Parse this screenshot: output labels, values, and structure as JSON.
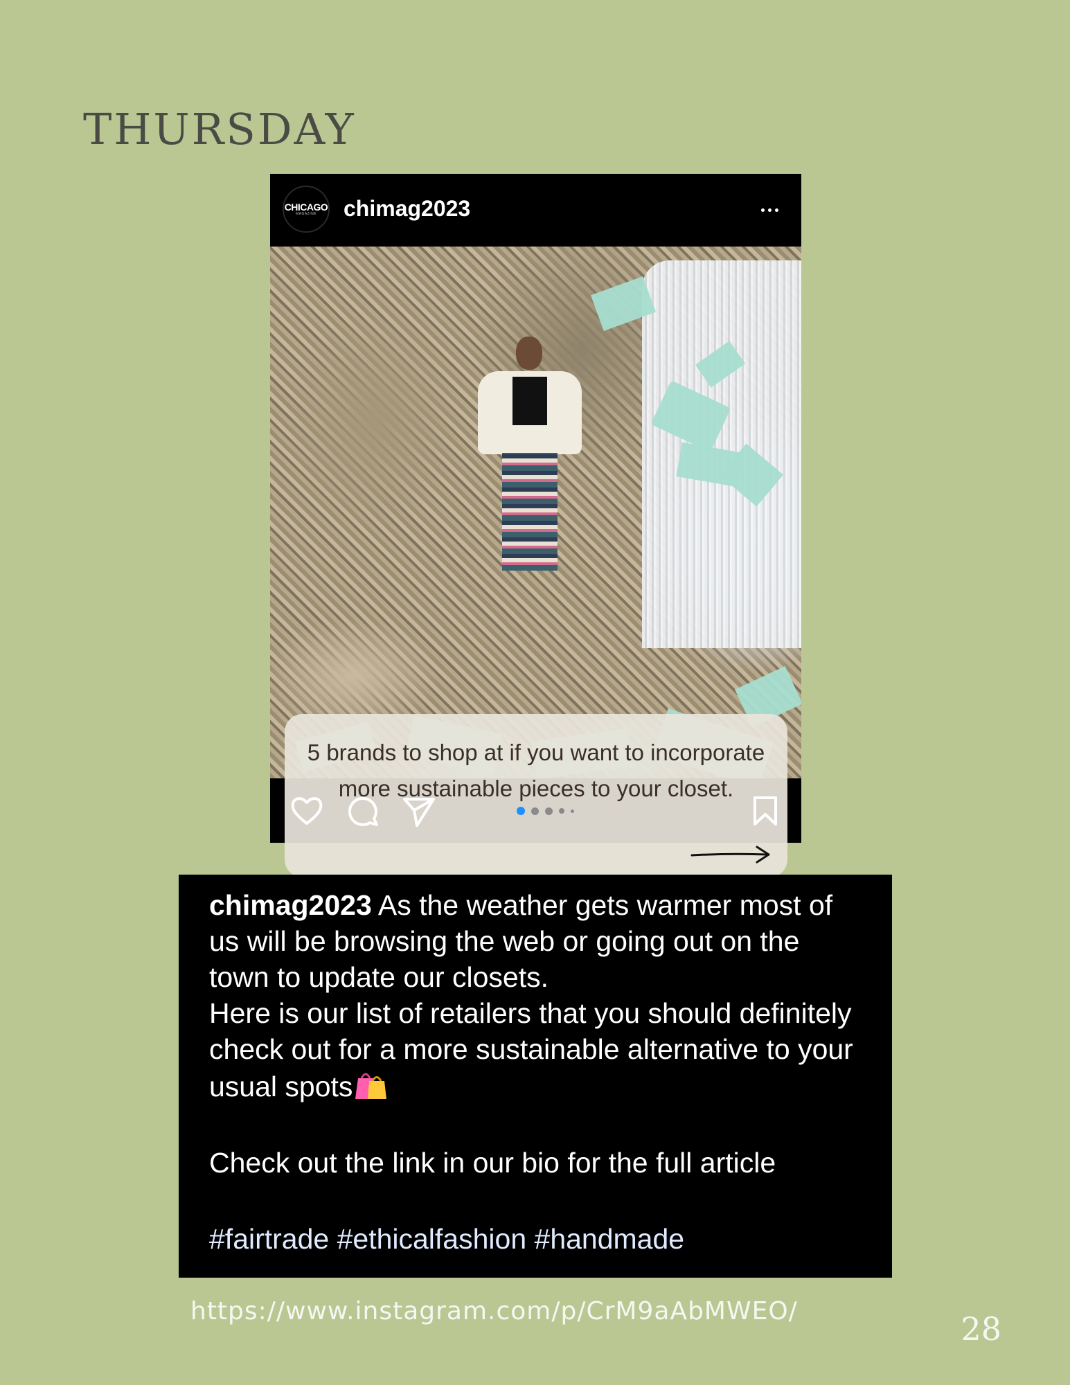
{
  "page": {
    "day_title": "THURSDAY",
    "url": "https://www.instagram.com/p/CrM9aAbMWEO/",
    "page_number": "28"
  },
  "post": {
    "avatar_text": "CHICAGO",
    "avatar_subtext": "MAGAZINE",
    "username": "chimag2023",
    "image_caption": "5 brands to shop at if you want to incorporate more sustainable pieces to your closet.",
    "carousel": {
      "total_dots": 5,
      "active_index": 0
    },
    "icons": [
      "heart-icon",
      "comment-icon",
      "share-icon",
      "bookmark-icon",
      "more-icon",
      "arrow-right-icon"
    ]
  },
  "comment": {
    "username": "chimag2023",
    "paragraph1": " As the weather gets warmer most of us will be browsing the web or going out on the town to update our closets.",
    "paragraph2": "Here is our list of retailers that you should definitely check out for a more sustainable alternative to your usual spots",
    "paragraph3": "Check out the link in our bio for the full article",
    "hashtags": "#fairtrade #ethicalfashion #handmade"
  },
  "colors": {
    "page_background": "#bac793",
    "post_background": "#000000",
    "active_dot": "#1e90ff",
    "bag_icon": "#ff5fae"
  }
}
